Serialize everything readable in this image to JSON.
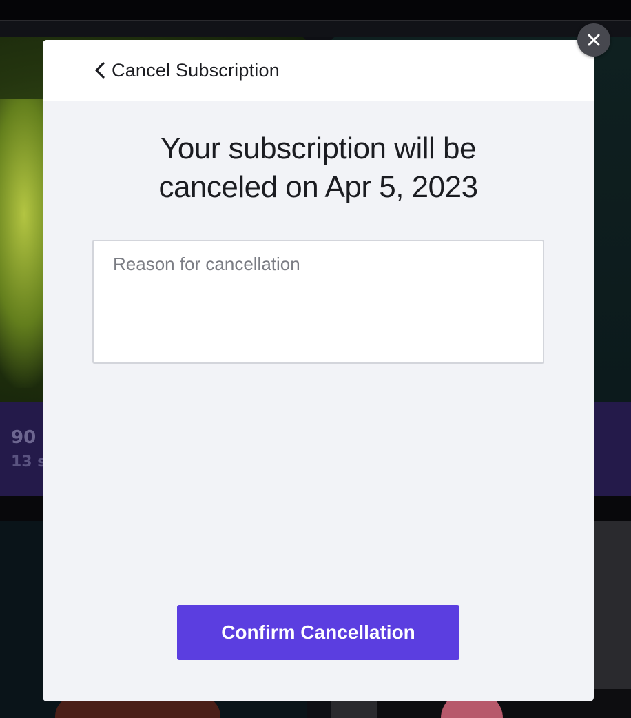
{
  "modal": {
    "back_label": "Cancel Subscription",
    "heading_line1": "Your subscription will be",
    "heading_line2": "canceled on Apr 5, 2023",
    "reason_placeholder": "Reason for cancellation",
    "reason_value": "",
    "confirm_label": "Confirm Cancellation"
  },
  "background": {
    "info_number": "90",
    "info_sub": "13 s"
  },
  "icons": {
    "back": "chevron-left-icon",
    "close": "close-icon"
  },
  "colors": {
    "accent": "#5b3ee0",
    "modal_bg": "#f2f3f7",
    "header_bg": "#ffffff",
    "close_bg": "#47484f",
    "info_bar": "#241a4a"
  }
}
